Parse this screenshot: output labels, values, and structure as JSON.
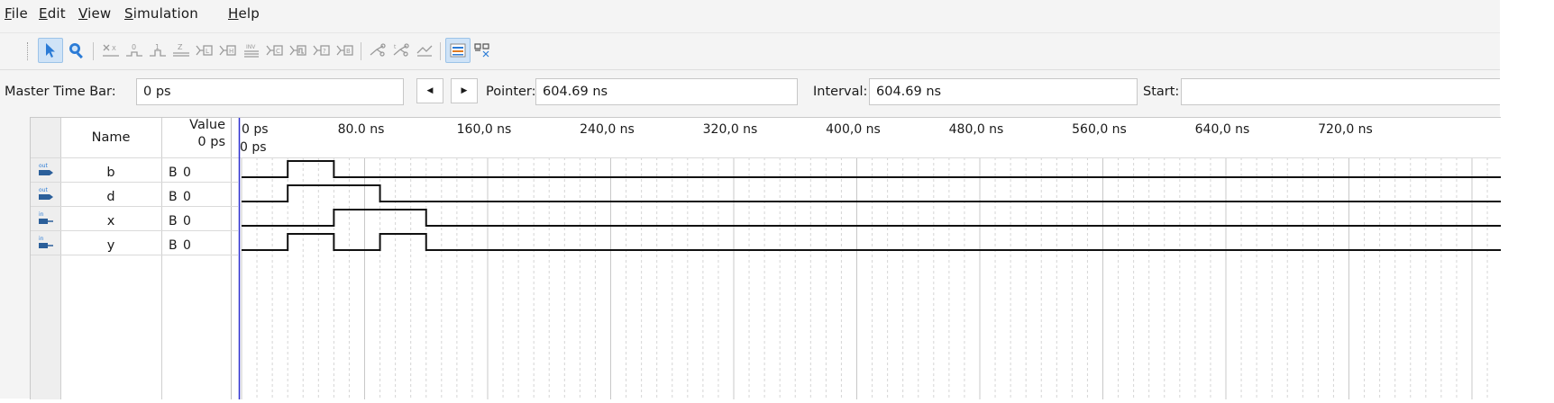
{
  "menu": {
    "file": {
      "key": "F",
      "rest": "ile"
    },
    "edit": {
      "key": "E",
      "rest": "dit"
    },
    "view": {
      "key": "V",
      "rest": "iew"
    },
    "simulation": {
      "key": "S",
      "rest": "imulation"
    },
    "help": {
      "key": "H",
      "rest": "elp"
    }
  },
  "toolbar": {
    "icons": [
      "selection-tool-icon",
      "zoom-tool-icon",
      "uninitialized-icon",
      "forcing-low-icon",
      "forcing-high-icon",
      "high-impedance-icon",
      "weak-low-icon",
      "weak-high-icon",
      "invert-icon",
      "count-value-icon",
      "clock-icon",
      "random-value-icon",
      "arbitrary-value-icon",
      "run-functional-simulation-icon",
      "run-timing-simulation-icon",
      "generate-netlist-icon",
      "snap-to-grid-icon",
      "grid-settings-icon"
    ]
  },
  "timebar": {
    "master_label": "Master Time Bar:",
    "master_value": "0 ps",
    "pointer_label": "Pointer:",
    "pointer_value": "604.69 ns",
    "interval_label": "Interval:",
    "interval_value": "604.69 ns",
    "start_label": "Start:",
    "start_value": ""
  },
  "table": {
    "name_header": "Name",
    "value_header": "Value",
    "value_time": "0 ps",
    "wave_time": "0 ps",
    "ticks": [
      "0 ps",
      "80.0 ns",
      "160,0 ns",
      "240,0 ns",
      "320,0 ns",
      "400,0 ns",
      "480,0 ns",
      "560,0 ns",
      "640,0 ns",
      "720,0 ns"
    ],
    "signals": [
      {
        "type": "out",
        "name": "b",
        "value": "B 0"
      },
      {
        "type": "out",
        "name": "d",
        "value": "B 0"
      },
      {
        "type": "in",
        "name": "x",
        "value": "B 0"
      },
      {
        "type": "in",
        "name": "y",
        "value": "B 0"
      }
    ],
    "tick_ns": [
      0,
      80,
      160,
      240,
      320,
      400,
      480,
      560,
      640,
      720
    ],
    "waveforms": {
      "b": [
        [
          0,
          0
        ],
        [
          30,
          1
        ],
        [
          60,
          0
        ]
      ],
      "d": [
        [
          0,
          0
        ],
        [
          30,
          1
        ],
        [
          90,
          0
        ]
      ],
      "x": [
        [
          0,
          0
        ],
        [
          60,
          1
        ],
        [
          120,
          0
        ]
      ],
      "y": [
        [
          0,
          0
        ],
        [
          30,
          1
        ],
        [
          60,
          0
        ],
        [
          90,
          1
        ],
        [
          120,
          0
        ]
      ]
    }
  },
  "colors": {
    "accent": "#2b7bd6",
    "wave": "#111111",
    "cursor": "#2c2fd0",
    "grid_minor": "#d5d5d5"
  }
}
